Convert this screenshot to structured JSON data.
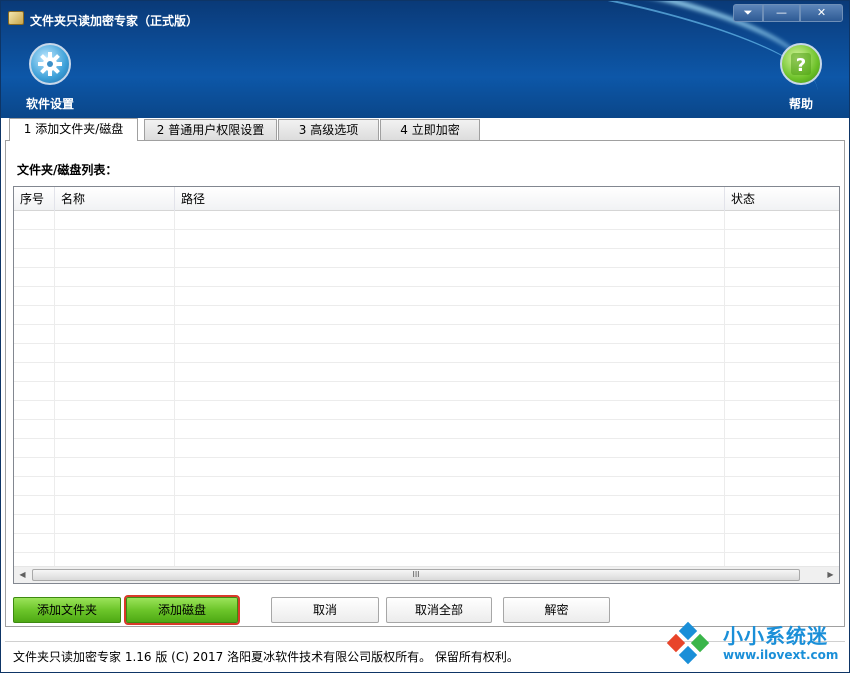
{
  "window": {
    "title": "文件夹只读加密专家（正式版）",
    "controls": {
      "menu": "⏷",
      "minimize": "—",
      "close": "✕"
    }
  },
  "header": {
    "settings_label": "软件设置",
    "help_label": "帮助"
  },
  "tabs": [
    {
      "label": "1 添加文件夹/磁盘",
      "active": true
    },
    {
      "label": "2 普通用户权限设置",
      "active": false
    },
    {
      "label": "3 高级选项",
      "active": false
    },
    {
      "label": "4 立即加密",
      "active": false
    }
  ],
  "list": {
    "caption": "文件夹/磁盘列表：",
    "columns": [
      "序号",
      "名称",
      "路径",
      "状态"
    ],
    "rows": [],
    "scrollbar": {
      "thumb_grip": "III"
    }
  },
  "buttons": {
    "add_folder": "添加文件夹",
    "add_disk": "添加磁盘",
    "cancel": "取消",
    "cancel_all": "取消全部",
    "decrypt": "解密"
  },
  "status": {
    "text": "文件夹只读加密专家 1.16 版  (C)  2017 洛阳夏冰软件技术有限公司版权所有。 保留所有权利。"
  },
  "watermark": {
    "title": "小小系统迷",
    "url": "www.ilovext.com"
  },
  "colors": {
    "header_bg": "#0c4a93",
    "green_button": "#6cc52a",
    "highlight_outline": "#d83a2a",
    "watermark_blue": "#1a8fd8"
  }
}
